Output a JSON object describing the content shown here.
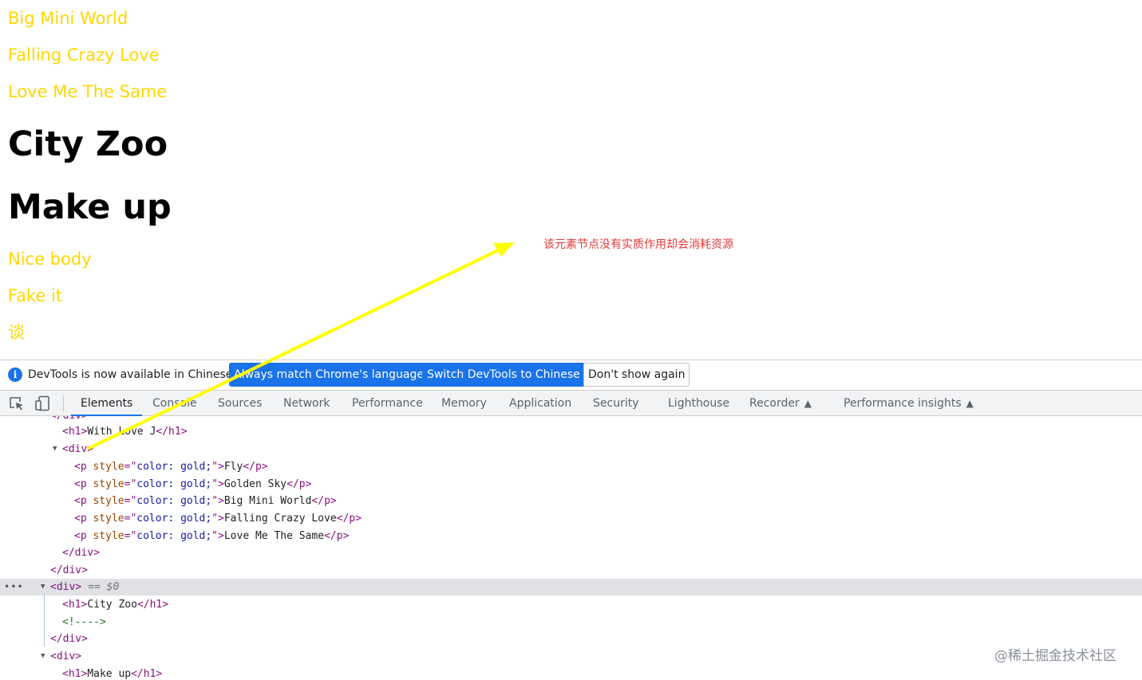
{
  "page": {
    "gold_lines_top": [
      "Big Mini World",
      "Falling Crazy Love",
      "Love Me The Same"
    ],
    "headings": [
      "City Zoo",
      "Make up"
    ],
    "gold_lines_bottom": [
      "Nice body",
      "Fake it",
      "谈"
    ],
    "annotation": "该元素节点没有实质作用却会消耗资源",
    "colors": {
      "gold": "#ffd700",
      "annotation": "#e53935",
      "arrow": "#ffff00"
    }
  },
  "infobar": {
    "message": "DevTools is now available in Chinese!",
    "buttons": [
      "Always match Chrome's language",
      "Switch DevTools to Chinese",
      "Don't show again"
    ]
  },
  "tabs": [
    "Elements",
    "Console",
    "Sources",
    "Network",
    "Performance",
    "Memory",
    "Application",
    "Security",
    "Lighthouse",
    "Recorder",
    "Performance insights"
  ],
  "active_tab": "Elements",
  "dom": {
    "line0": "</div>",
    "h1_with_love": "With Love J",
    "p_style_attr": "style",
    "p_style_val": "color: gold;",
    "p_texts": [
      "Fly",
      "Golden Sky",
      "Big Mini World",
      "Falling Crazy Love",
      "Love Me The Same"
    ],
    "selected_suffix": "== $0",
    "h1_city_zoo": "City Zoo",
    "comment": "<!---->",
    "h1_make_up": "Make up"
  },
  "watermark": "@稀土掘金技术社区"
}
